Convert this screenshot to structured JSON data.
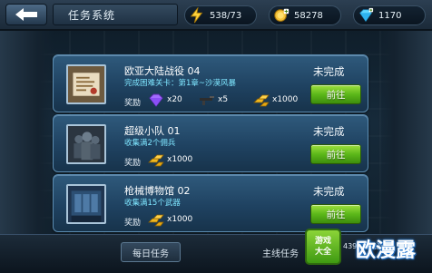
{
  "header": {
    "back_icon": "back-arrow-icon",
    "title": "任务系统",
    "resources": [
      {
        "icon": "energy-icon",
        "value": "538/73"
      },
      {
        "icon": "gold-coin-icon",
        "value": "58278"
      },
      {
        "icon": "diamond-icon",
        "value": "1170"
      }
    ]
  },
  "tasks": [
    {
      "title": "欧亚大陆战役 04",
      "subtitle": "完成困难关卡：第1章~沙漠风暴",
      "reward_label": "奖励",
      "rewards": [
        {
          "icon": "gem-icon",
          "value": "x20"
        },
        {
          "icon": "rifle-icon",
          "value": "x5"
        },
        {
          "icon": "gold-bars-icon",
          "value": "x1000"
        }
      ],
      "status": "未完成",
      "button": "前往"
    },
    {
      "title": "超级小队 01",
      "subtitle": "收集满2个佣兵",
      "reward_label": "奖励",
      "rewards": [
        {
          "icon": "gold-bars-icon",
          "value": "x1000"
        }
      ],
      "status": "未完成",
      "button": "前往"
    },
    {
      "title": "枪械博物馆 02",
      "subtitle": "收集满15个武器",
      "reward_label": "奖励",
      "rewards": [
        {
          "icon": "gold-bars-icon",
          "value": "x1000"
        }
      ],
      "status": "未完成",
      "button": "前往"
    }
  ],
  "footer": {
    "tabs": [
      "每日任务",
      "主线任务"
    ],
    "logo_line1": "游戏",
    "logo_line2": "大全",
    "domain": "4399手机游戏",
    "watermark": "欧漫露"
  }
}
